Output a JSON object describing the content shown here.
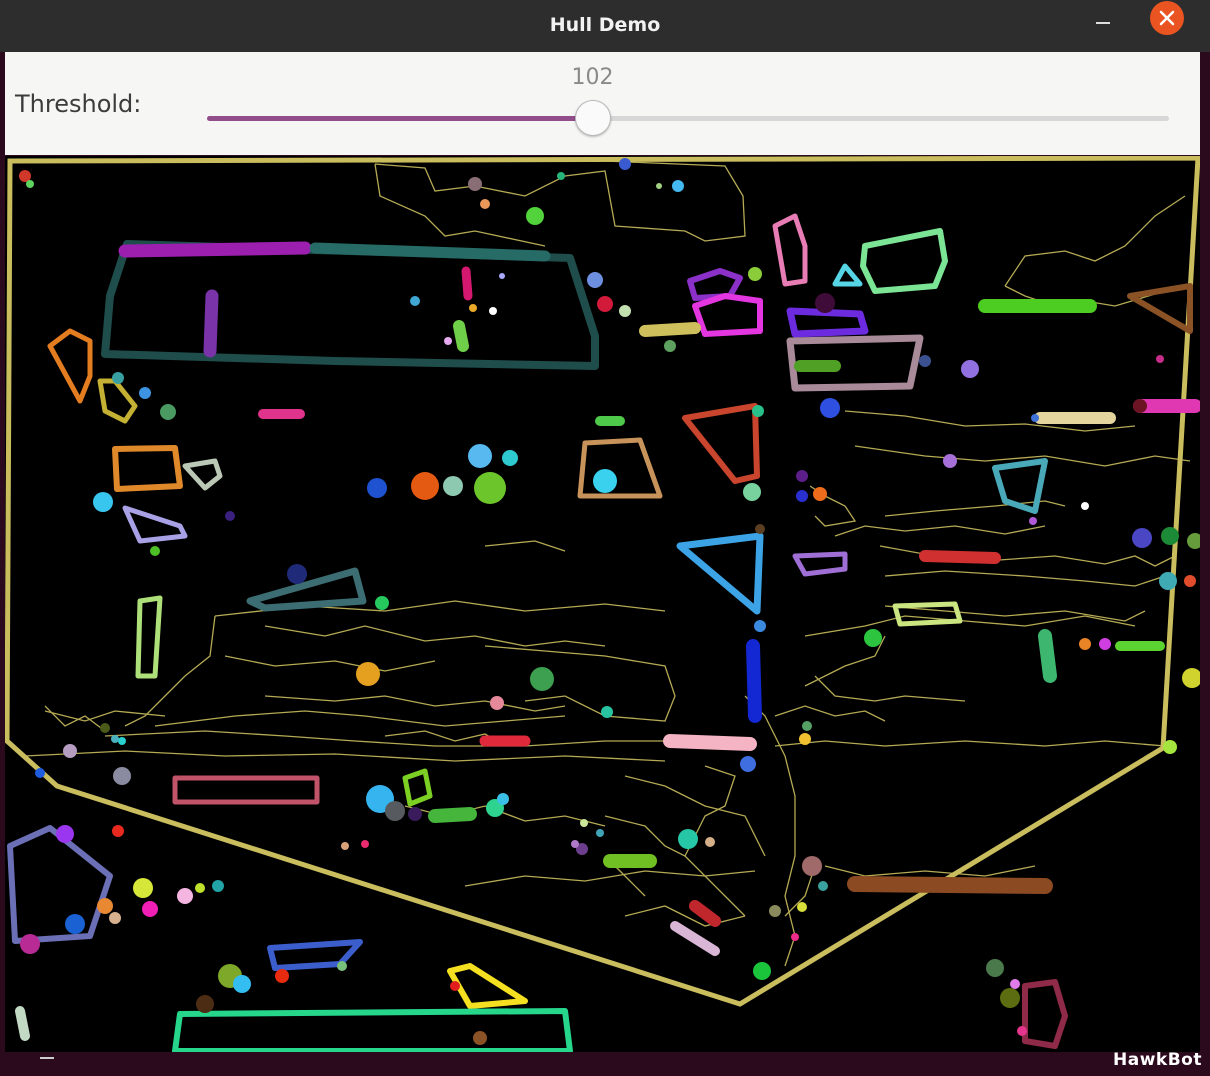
{
  "window": {
    "title": "Hull Demo"
  },
  "controls": {
    "threshold_label": "Threshold:",
    "slider": {
      "value": "102",
      "fraction": 0.4,
      "fill_color": "#924d8b"
    }
  },
  "canvas": {
    "background": "#000000",
    "hull_color": "#c9bd5e",
    "contour_color": "#c9bd5e"
  },
  "watermark": "HawkBot",
  "icons": {
    "minimize": "minimize-icon",
    "close": "close-icon"
  },
  "colors": {
    "titlebar": "#2d2d2d",
    "close_button": "#e95420",
    "control_panel": "#f6f6f5"
  }
}
